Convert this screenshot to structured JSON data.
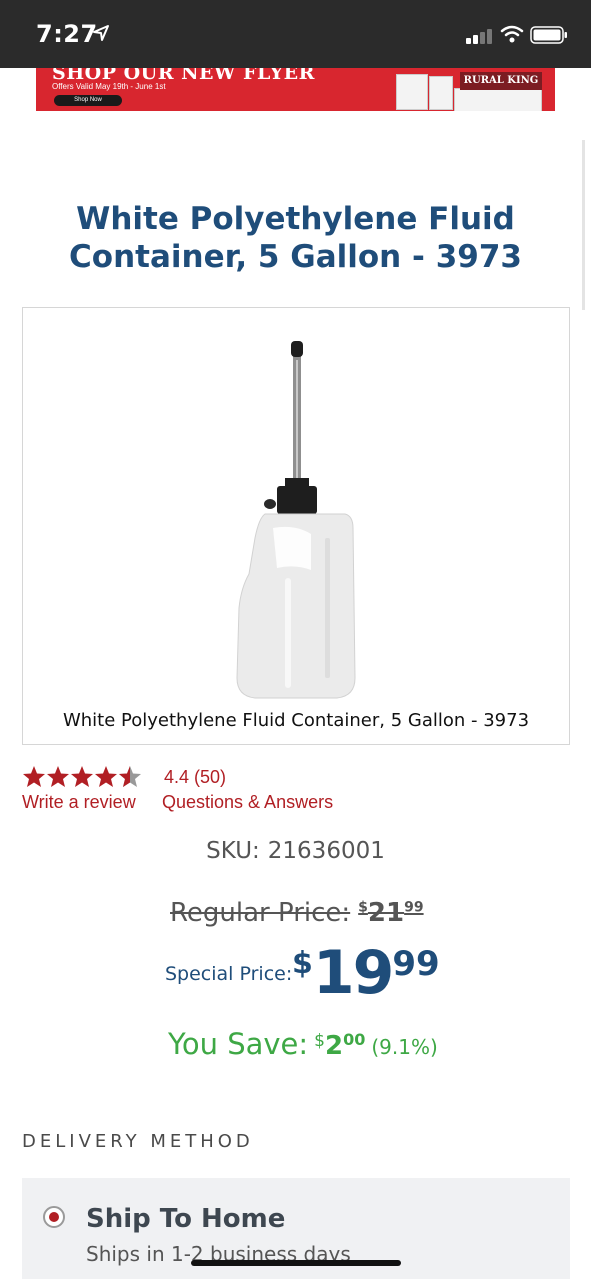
{
  "status_bar": {
    "time": "7:27"
  },
  "banner": {
    "headline": "SHOP OUR NEW FLYER",
    "subtext": "Offers Valid May 19th - June 1st",
    "button_label": "Shop Now",
    "brand": "RURAL KING"
  },
  "product": {
    "title": "White Polyethylene Fluid Container, 5 Gallon - 3973",
    "image_caption": "White Polyethylene Fluid Container, 5 Gallon - 3973"
  },
  "reviews": {
    "stars": 4.4,
    "rating_text": "4.4 (50)",
    "write_review": "Write a review",
    "qa": "Questions & Answers"
  },
  "sku": {
    "label": "SKU:",
    "value": "21636001"
  },
  "pricing": {
    "regular_label": "Regular Price:",
    "regular_currency": "$",
    "regular_dollars": "21",
    "regular_cents": "99",
    "special_label": "Special Price:",
    "special_currency": "$",
    "special_dollars": "19",
    "special_cents": "99",
    "save_label": "You Save:",
    "save_currency": "$",
    "save_dollars": "2",
    "save_cents": "00",
    "save_percent": "(9.1%)"
  },
  "delivery": {
    "heading": "DELIVERY METHOD",
    "option_title": "Ship To Home",
    "option_sub": "Ships in 1-2 business days"
  },
  "colors": {
    "brand_red": "#b11f24",
    "title_blue": "#1f4d7a",
    "save_green": "#3ea845",
    "banner_red": "#d8262f"
  }
}
